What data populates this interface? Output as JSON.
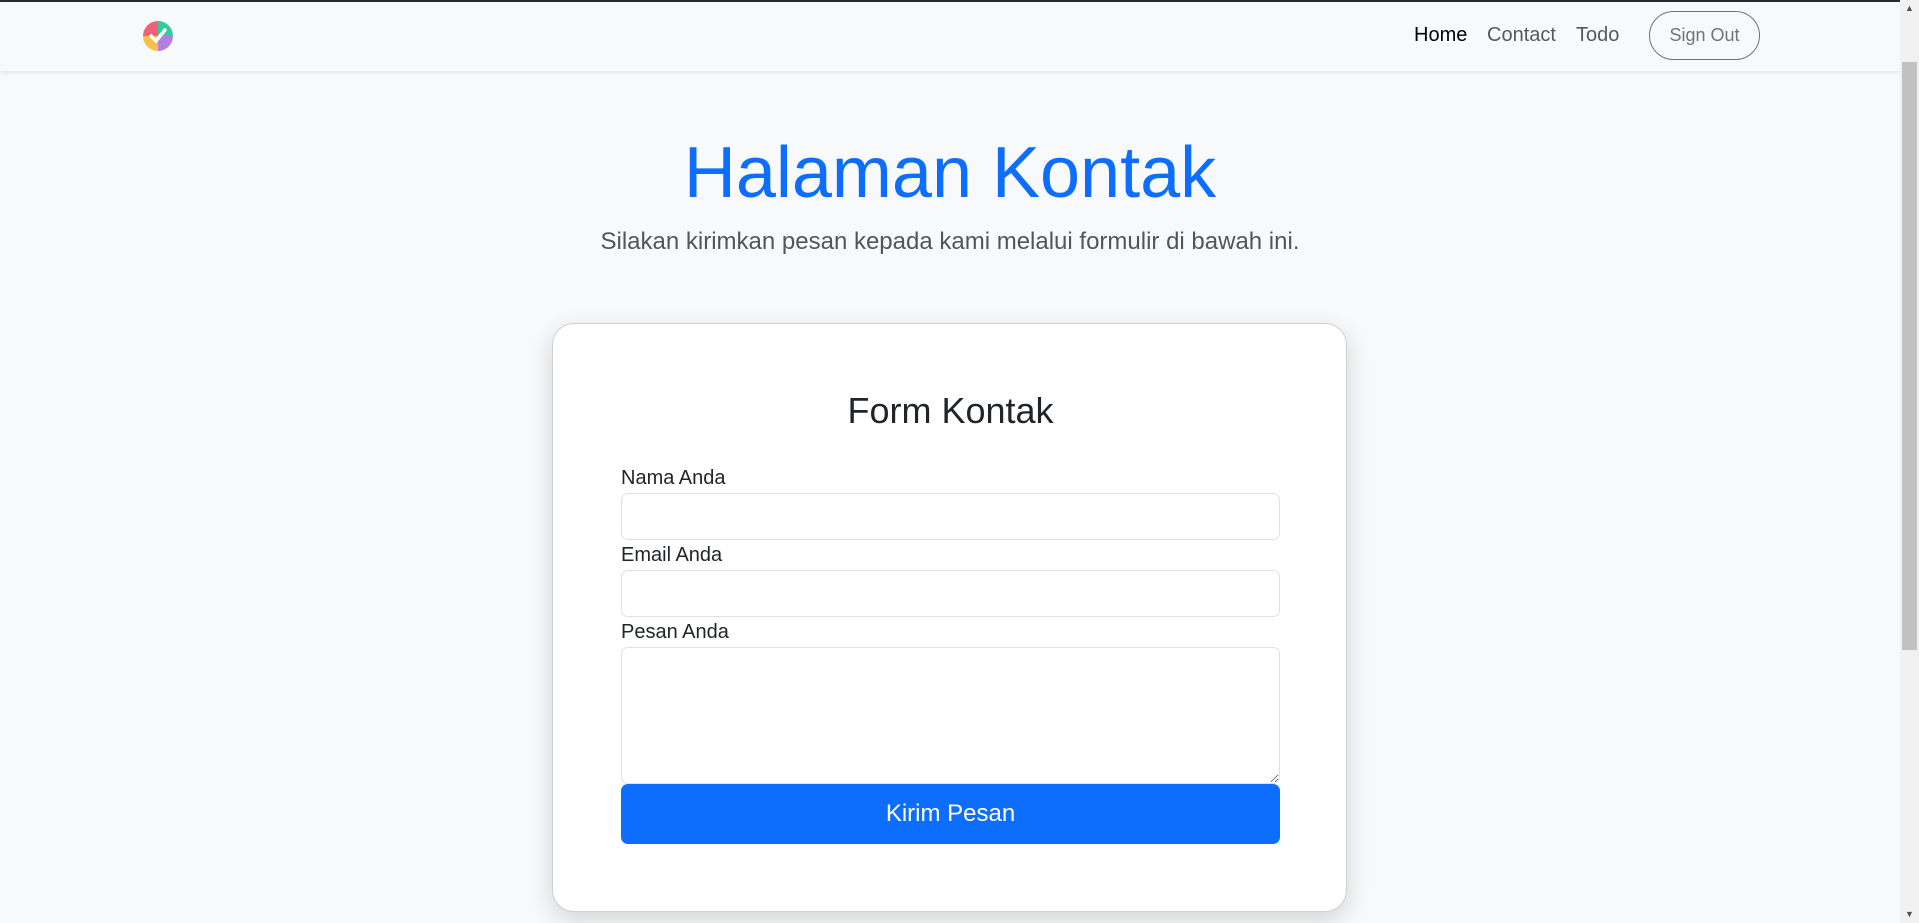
{
  "nav": {
    "links": [
      {
        "label": "Home",
        "active": true
      },
      {
        "label": "Contact",
        "active": false
      },
      {
        "label": "Todo",
        "active": false
      }
    ],
    "signout_label": "Sign Out"
  },
  "hero": {
    "title": "Halaman Kontak",
    "subtitle": "Silakan kirimkan pesan kepada kami melalui formulir di bawah ini."
  },
  "form": {
    "title": "Form Kontak",
    "name_label": "Nama Anda",
    "name_value": "",
    "email_label": "Email Anda",
    "email_value": "",
    "message_label": "Pesan Anda",
    "message_value": "",
    "submit_label": "Kirim Pesan"
  },
  "colors": {
    "primary": "#0d6efd",
    "background": "#f8f9fa",
    "muted": "#6c757d"
  },
  "icons": {
    "logo": "checkmark-logo-icon",
    "scroll_up": "scroll-up-arrow-icon",
    "scroll_down": "scroll-down-arrow-icon"
  }
}
